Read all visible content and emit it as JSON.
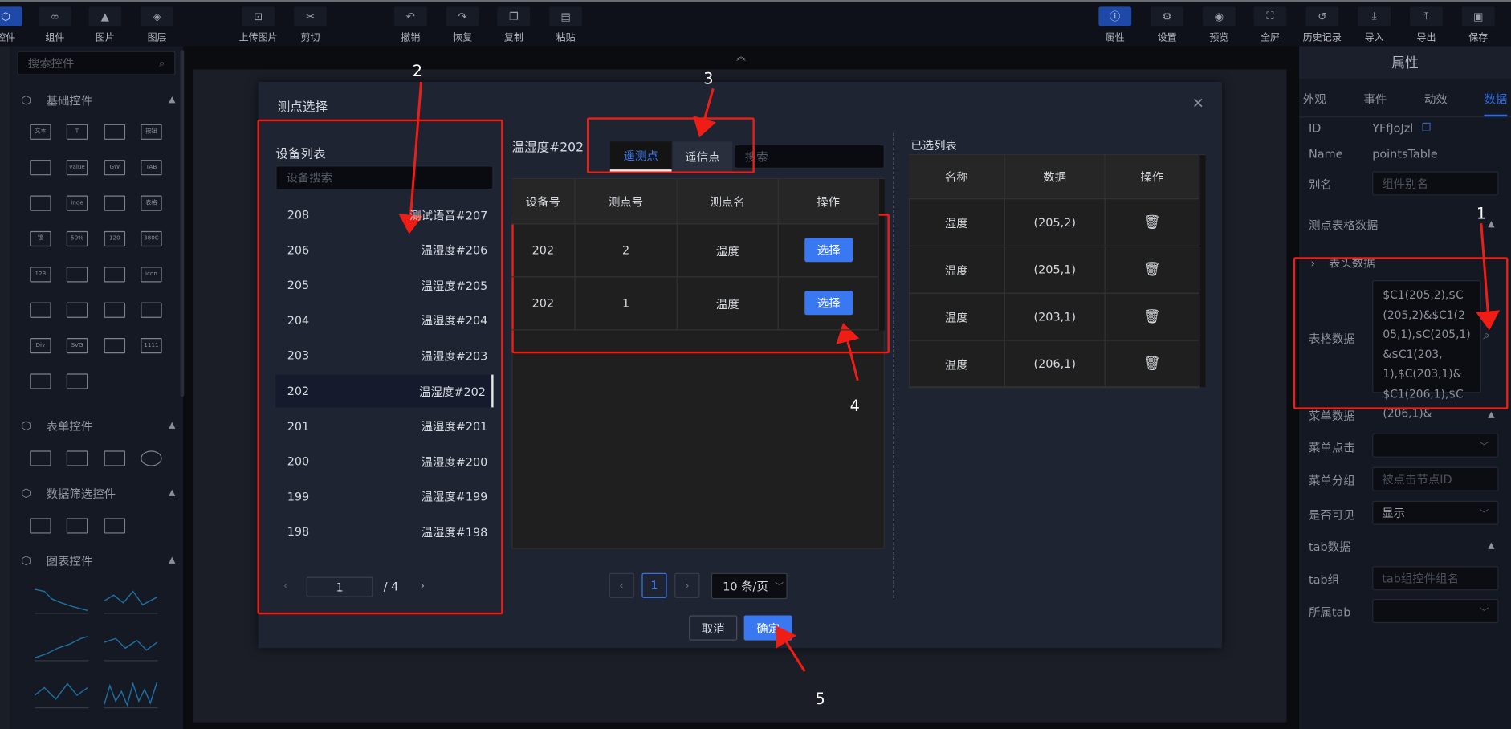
{
  "toolbar": {
    "left": [
      {
        "label": "控件",
        "icon": "cube-icon",
        "active": true
      },
      {
        "label": "组件",
        "icon": "link-icon"
      },
      {
        "label": "图片",
        "icon": "image-icon"
      },
      {
        "label": "图层",
        "icon": "layers-icon"
      },
      {
        "label": "上传图片",
        "icon": "upload-image-icon"
      },
      {
        "label": "剪切",
        "icon": "cut-icon"
      },
      {
        "label": "撤销",
        "icon": "undo-icon"
      },
      {
        "label": "恢复",
        "icon": "redo-icon"
      },
      {
        "label": "复制",
        "icon": "copy-icon"
      },
      {
        "label": "粘贴",
        "icon": "paste-icon"
      }
    ],
    "right": [
      {
        "label": "属性",
        "icon": "info-icon",
        "active": true
      },
      {
        "label": "设置",
        "icon": "gear-icon"
      },
      {
        "label": "预览",
        "icon": "preview-icon"
      },
      {
        "label": "全屏",
        "icon": "fullscreen-icon"
      },
      {
        "label": "历史记录",
        "icon": "history-icon"
      },
      {
        "label": "导入",
        "icon": "import-icon"
      },
      {
        "label": "导出",
        "icon": "export-icon"
      },
      {
        "label": "保存",
        "icon": "save-icon"
      }
    ]
  },
  "sidebar": {
    "search_placeholder": "搜索控件",
    "sections": [
      {
        "title": "基础控件",
        "items": [
          "文本",
          "T",
          "",
          "按钮",
          "",
          "value",
          "GW",
          "TAB",
          "",
          "Inde",
          "",
          "表格",
          "锁",
          "50%",
          "120",
          "380C",
          "123",
          "",
          "",
          "icon",
          "",
          "",
          "",
          "",
          "Div",
          "SVG",
          "",
          "1111",
          "",
          ""
        ]
      },
      {
        "title": "表单控件"
      },
      {
        "title": "数据筛选控件"
      },
      {
        "title": "图表控件"
      }
    ]
  },
  "dialog": {
    "title": "测点选择",
    "device_list": {
      "title": "设备列表",
      "search_placeholder": "设备搜索",
      "rows": [
        {
          "id": "208",
          "name": "测试语音#207"
        },
        {
          "id": "206",
          "name": "温湿度#206"
        },
        {
          "id": "205",
          "name": "温湿度#205"
        },
        {
          "id": "204",
          "name": "温湿度#204"
        },
        {
          "id": "203",
          "name": "温湿度#203"
        },
        {
          "id": "202",
          "name": "温湿度#202",
          "selected": true
        },
        {
          "id": "201",
          "name": "温湿度#201"
        },
        {
          "id": "200",
          "name": "温湿度#200"
        },
        {
          "id": "199",
          "name": "温湿度#199"
        },
        {
          "id": "198",
          "name": "温湿度#198"
        }
      ],
      "page": "1",
      "total_pages": "/ 4"
    },
    "points": {
      "device_title": "温湿度#202",
      "tabs": [
        {
          "label": "遥测点",
          "active": true
        },
        {
          "label": "遥信点"
        }
      ],
      "search_placeholder": "搜索",
      "columns": [
        "设备号",
        "测点号",
        "测点名",
        "操作"
      ],
      "rows": [
        {
          "device": "202",
          "point": "2",
          "name": "湿度",
          "action": "选择"
        },
        {
          "device": "202",
          "point": "1",
          "name": "温度",
          "action": "选择"
        }
      ],
      "page": "1",
      "page_size": "10 条/页"
    },
    "selected": {
      "title": "已选列表",
      "columns": [
        "名称",
        "数据",
        "操作"
      ],
      "rows": [
        {
          "name": "湿度",
          "data": "(205,2)"
        },
        {
          "name": "温度",
          "data": "(205,1)"
        },
        {
          "name": "温度",
          "data": "(203,1)"
        },
        {
          "name": "温度",
          "data": "(206,1)"
        }
      ]
    },
    "cancel": "取消",
    "confirm": "确定"
  },
  "props": {
    "header": "属性",
    "tabs": [
      {
        "label": "外观"
      },
      {
        "label": "事件"
      },
      {
        "label": "动效"
      },
      {
        "label": "数据",
        "active": true
      }
    ],
    "id_label": "ID",
    "id_value": "YFfJoJzl",
    "name_label": "Name",
    "name_value": "pointsTable",
    "alias_label": "别名",
    "alias_placeholder": "组件别名",
    "points_section": "测点表格数据",
    "header_data": "表头数据",
    "table_data_label": "表格数据",
    "table_data_value": "$C1(205,2),$C(205,2)&$C1(205,1),$C(205,1)&$C1(203,1),$C(203,1)&$C1(206,1),$C(206,1)&",
    "menu_section": "菜单数据",
    "menu_click_label": "菜单点击",
    "menu_group_label": "菜单分组",
    "menu_group_placeholder": "被点击节点ID",
    "visible_label": "是否可见",
    "visible_value": "显示",
    "tab_section": "tab数据",
    "tab_group_label": "tab组",
    "tab_group_placeholder": "tab组控件组名",
    "tab_belong_label": "所属tab"
  },
  "annotations": [
    "1",
    "2",
    "3",
    "4",
    "5"
  ],
  "colors": {
    "accent": "#3a78f2",
    "annotation": "#f01d15",
    "panel": "#1f2433"
  }
}
